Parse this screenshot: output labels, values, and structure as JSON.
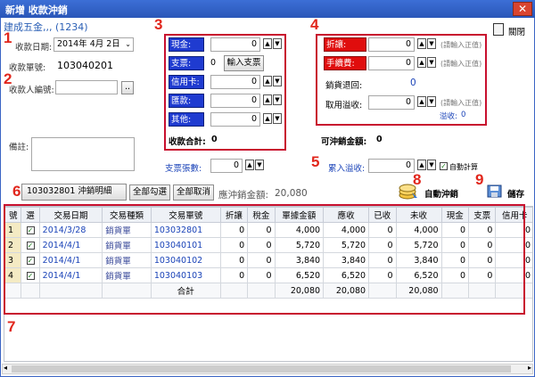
{
  "window": {
    "title": "新增 收款沖銷",
    "close": "✕"
  },
  "company": "建成五金,,, (1234)",
  "markers": [
    "1",
    "2",
    "3",
    "4",
    "5",
    "6",
    "7",
    "8",
    "9"
  ],
  "close_action": {
    "label": "關閉"
  },
  "form": {
    "date_label": "收款日期:",
    "date_value": "2014年 4月 2日",
    "receipt_no_label": "收款單號:",
    "receipt_no_value": "103040201",
    "payer_label": "收款人編號:",
    "payer_value": "",
    "payer_btn": "..",
    "note_label": "備註:",
    "note_value": ""
  },
  "payment": {
    "cash": {
      "label": "現金:",
      "value": "0"
    },
    "check": {
      "label": "支票:",
      "value": "0",
      "button": "輸入支票"
    },
    "card": {
      "label": "信用卡:",
      "value": "0"
    },
    "remit": {
      "label": "匯款:",
      "value": "0"
    },
    "other": {
      "label": "其他:",
      "value": "0"
    },
    "total_label": "收款合計:",
    "total_value": "0",
    "check_count_label": "支票張數:",
    "check_count_value": "0"
  },
  "adjust": {
    "discount": {
      "label": "折讓:",
      "value": "0",
      "hint": "(請輸入正值)"
    },
    "fee": {
      "label": "手續費:",
      "value": "0",
      "hint": "(請輸入正值)"
    },
    "return_label": "銷貨退回:",
    "return_value": "0",
    "overpay_use_label": "取用溢收:",
    "overpay_use_value": "0",
    "overpay_use_hint": "(請輸入正值)",
    "overpay_label": "溢收:",
    "overpay_value": "0",
    "writeoff_label": "可沖銷金額:",
    "writeoff_value": "0",
    "accum_label": "累入溢收:",
    "accum_value": "0",
    "auto_calc_label": "自動計算"
  },
  "toolbar": {
    "detail_tab": "103032801 沖銷明細",
    "select_all": "全部勾選",
    "deselect_all": "全部取消",
    "due_label": "應沖銷金額:",
    "due_value": "20,080",
    "auto_writeoff": "自動沖銷",
    "save": "儲存"
  },
  "table": {
    "headers": [
      "號",
      "選",
      "交易日期",
      "交易種類",
      "交易單號",
      "折讓",
      "稅金",
      "單據金額",
      "應收",
      "已收",
      "未收",
      "現金",
      "支票",
      "信用卡"
    ],
    "rows": [
      [
        "1",
        "✓",
        "2014/3/28",
        "銷貨單",
        "103032801",
        "0",
        "0",
        "4,000",
        "4,000",
        "0",
        "4,000",
        "0",
        "0",
        "0"
      ],
      [
        "2",
        "✓",
        "2014/4/1",
        "銷貨單",
        "103040101",
        "0",
        "0",
        "5,720",
        "5,720",
        "0",
        "5,720",
        "0",
        "0",
        "0"
      ],
      [
        "3",
        "✓",
        "2014/4/1",
        "銷貨單",
        "103040102",
        "0",
        "0",
        "3,840",
        "3,840",
        "0",
        "3,840",
        "0",
        "0",
        "0"
      ],
      [
        "4",
        "✓",
        "2014/4/1",
        "銷貨單",
        "103040103",
        "0",
        "0",
        "6,520",
        "6,520",
        "0",
        "6,520",
        "0",
        "0",
        "0"
      ]
    ],
    "totals": {
      "label": "合計",
      "amount": "20,080",
      "receivable": "20,080",
      "unpaid": "20,080"
    }
  }
}
